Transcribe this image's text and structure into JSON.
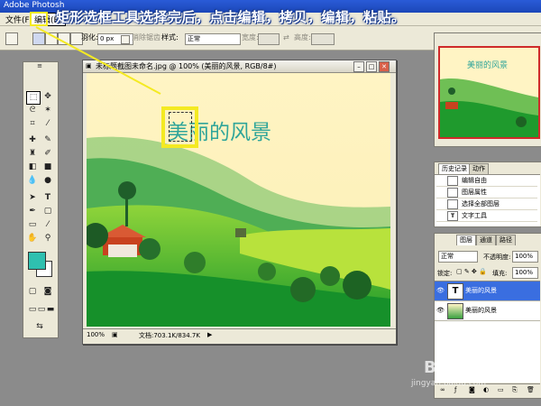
{
  "app": {
    "title": "Adobe Photosh"
  },
  "menubar": {
    "items": [
      "文件(F)",
      "编辑(E)"
    ],
    "selected_index": 1
  },
  "options": {
    "feather_label": "羽化:",
    "feather_value": "0 px",
    "antialias_label": "消除锯齿",
    "style_label": "样式:",
    "style_value": "正常",
    "width_label": "宽度:",
    "height_label": "高度:"
  },
  "caption": "矩形选框工具选择完后，点击编辑，拷贝，编辑，粘贴。",
  "document": {
    "title": "未标题截图未命名.jpg @ 100% (美丽的风景, RGB/8#)",
    "zoom": "100%",
    "doc_size": "文档:703.1K/834.7K",
    "text_layer_content": "美丽的风景"
  },
  "navigator": {
    "thumb_text": "美丽的风景"
  },
  "history": {
    "tabs": [
      "历史记录",
      "动作"
    ],
    "items": [
      {
        "label": "编辑自由",
        "icon": "doc-icon"
      },
      {
        "label": "图层属性",
        "icon": "doc-icon"
      },
      {
        "label": "选择全部图层",
        "icon": "doc-icon"
      },
      {
        "label": "文字工具",
        "icon": "T"
      }
    ]
  },
  "layers": {
    "tabs": [
      "图层",
      "通道",
      "路径"
    ],
    "blend_mode": "正常",
    "opacity_label": "不透明度:",
    "opacity_value": "100%",
    "lock_label": "锁定:",
    "fill_label": "填充:",
    "fill_value": "100%",
    "items": [
      {
        "name": "美丽的风景",
        "type": "text",
        "selected": true
      },
      {
        "name": "美丽的风景",
        "type": "image",
        "selected": false
      }
    ]
  },
  "watermark": {
    "brand": "Bai 经验",
    "url": "jingyan.baidu.com"
  },
  "colors": {
    "accent_yellow": "#f4ea22",
    "selection_blue": "#3a6ee0",
    "title_text": "#2fa59a"
  }
}
